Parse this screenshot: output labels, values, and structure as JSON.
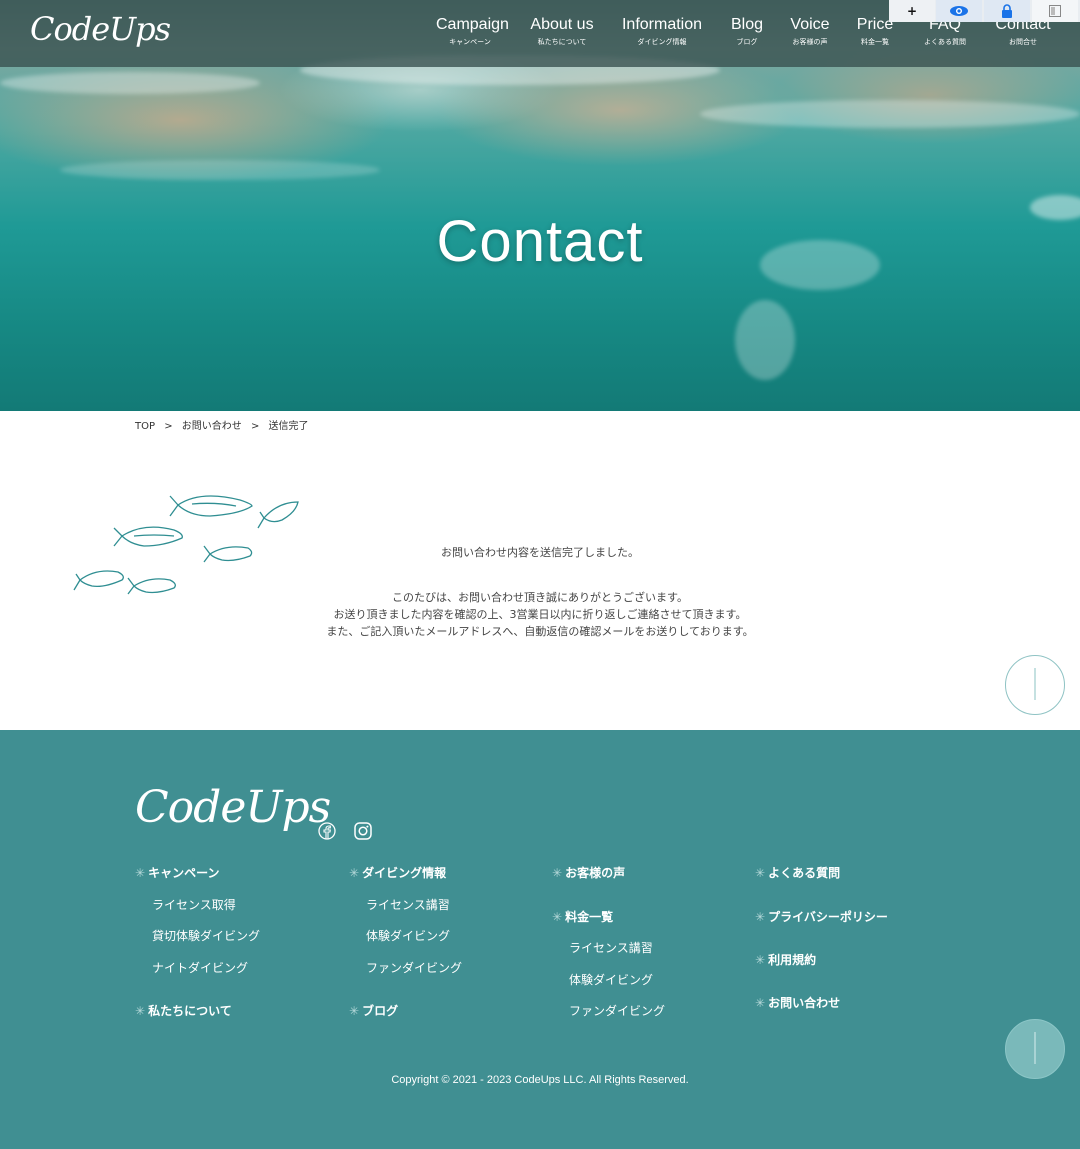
{
  "header": {
    "logo": "CodeUps",
    "nav": [
      {
        "en": "Campaign",
        "jp": "キャンペーン"
      },
      {
        "en": "About us",
        "jp": "私たちについて"
      },
      {
        "en": "Information",
        "jp": "ダイビング情報"
      },
      {
        "en": "Blog",
        "jp": "ブログ"
      },
      {
        "en": "Voice",
        "jp": "お客様の声"
      },
      {
        "en": "Price",
        "jp": "料金一覧"
      },
      {
        "en": "FAQ",
        "jp": "よくある質問"
      },
      {
        "en": "Contact",
        "jp": "お問合せ"
      }
    ],
    "toolbar": {
      "add": "+",
      "eye": "eye-icon",
      "lock": "lock-icon",
      "panel": "panel-icon"
    }
  },
  "hero": {
    "title": "Contact"
  },
  "breadcrumb": {
    "items": [
      "TOP",
      "お問い合わせ",
      "送信完了"
    ],
    "sep": ">"
  },
  "message": {
    "heading": "お問い合わせ内容を送信完了しました。",
    "lines": [
      "このたびは、お問い合わせ頂き誠にありがとうございます。",
      "お送り頂きました内容を確認の上、3営業日以内に折り返しご連絡させて頂きます。",
      "また、ご記入頂いたメールアドレスへ、自動返信の確認メールをお送りしております。"
    ]
  },
  "footer": {
    "logo": "CodeUps",
    "col1": {
      "head1": "キャンペーン",
      "links": [
        "ライセンス取得",
        "貸切体験ダイビング",
        "ナイトダイビング"
      ],
      "head2": "私たちについて"
    },
    "col2": {
      "head1": "ダイビング情報",
      "links": [
        "ライセンス講習",
        "体験ダイビング",
        "ファンダイビング"
      ],
      "head2": "ブログ"
    },
    "col3": {
      "head1": "お客様の声",
      "head2": "料金一覧",
      "links": [
        "ライセンス講習",
        "体験ダイビング",
        "ファンダイビング"
      ]
    },
    "col4": {
      "heads": [
        "よくある質問",
        "プライバシーポリシー",
        "利用規約",
        "お問い合わせ"
      ]
    },
    "copyright": "Copyright © 2021 - 2023 CodeUps LLC. All Rights Reserved."
  },
  "colors": {
    "footer_bg": "#408f92",
    "accent": "#408f92"
  }
}
